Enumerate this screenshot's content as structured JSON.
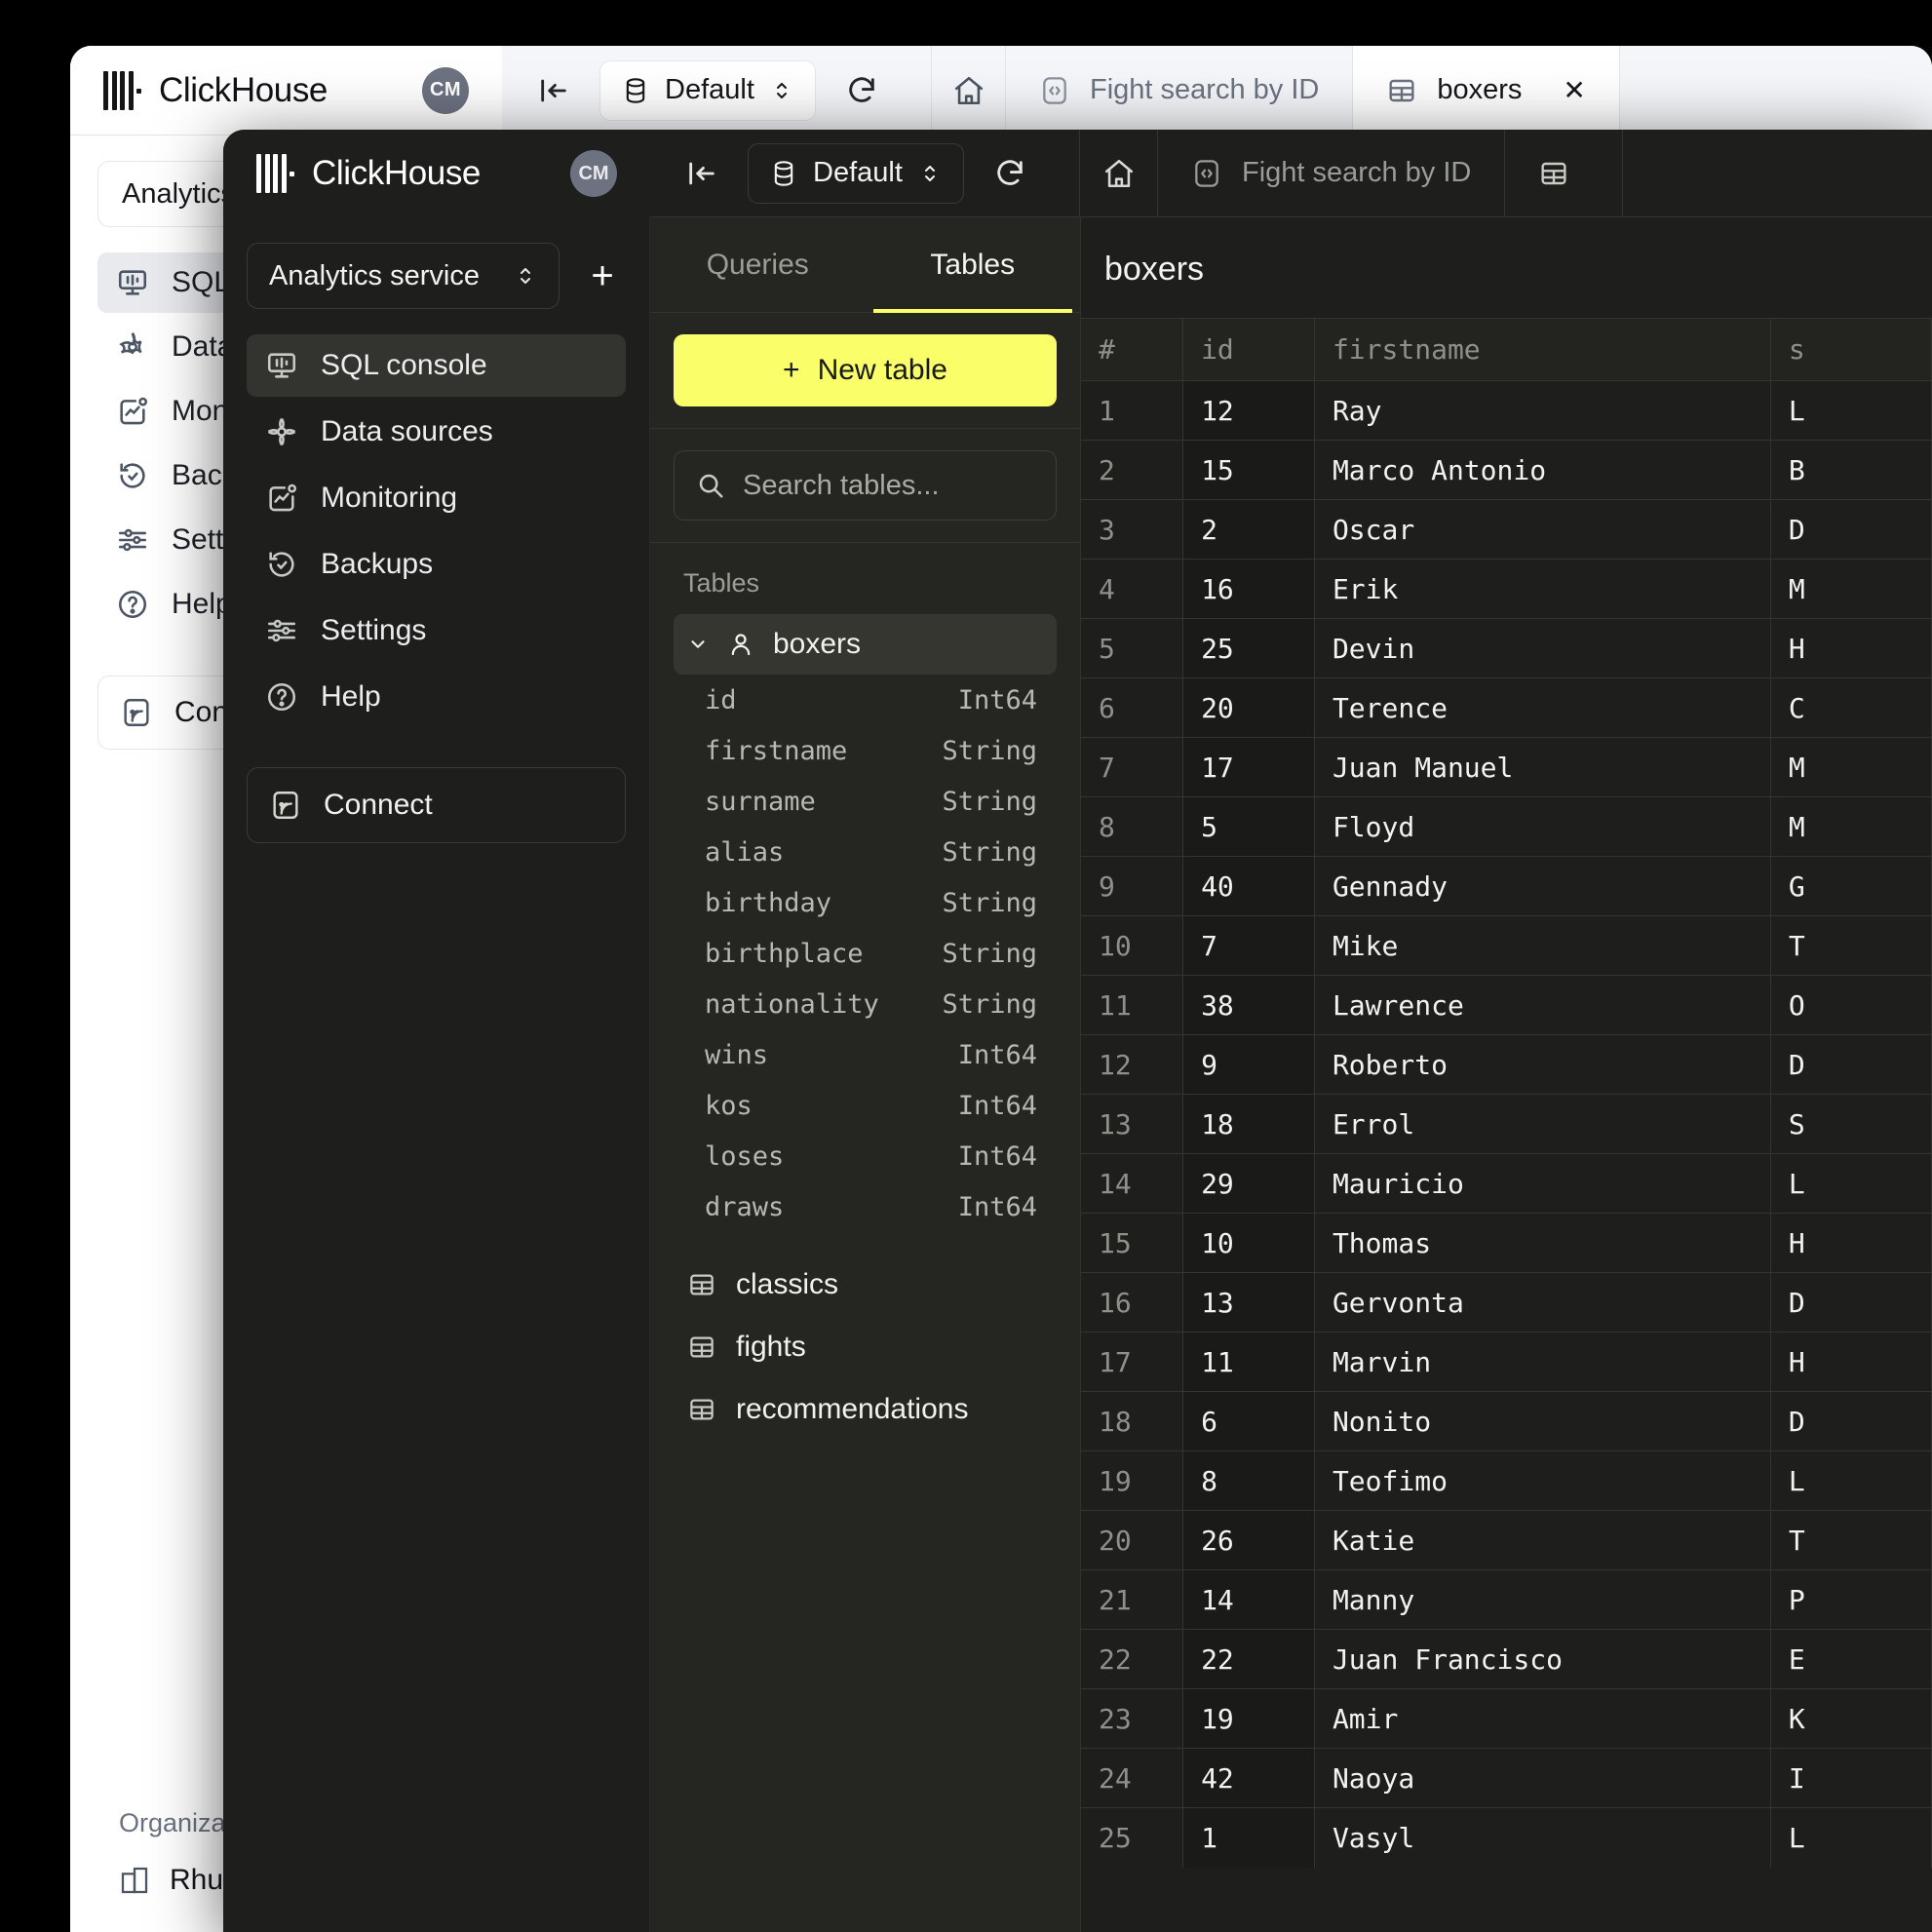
{
  "app": {
    "brand": "ClickHouse",
    "avatar_initials": "CM"
  },
  "base_window": {
    "toolbar": {
      "collapse_icon": "collapse-left-icon",
      "database_label": "Default",
      "refresh_icon": "refresh-icon",
      "home_icon": "home-icon"
    },
    "tabs": [
      {
        "label": "Fight search by ID",
        "icon": "code-square-icon",
        "active": false
      },
      {
        "label": "boxers",
        "icon": "table-icon",
        "active": true,
        "close_label": "✕"
      }
    ],
    "sidebar": {
      "service_selector": "Analytics service",
      "items": [
        {
          "label": "SQL console",
          "icon": "sql-console-icon",
          "active": true
        },
        {
          "label": "Data sources",
          "icon": "data-sources-icon",
          "active": false
        },
        {
          "label": "Monitoring",
          "icon": "monitoring-icon",
          "active": false
        },
        {
          "label": "Backups",
          "icon": "backups-icon",
          "active": false
        },
        {
          "label": "Settings",
          "icon": "settings-icon",
          "active": false
        },
        {
          "label": "Help",
          "icon": "help-icon",
          "active": false
        }
      ],
      "connect_label": "Connect",
      "organization_label": "Organization",
      "organization_name": "Rhubarb"
    }
  },
  "dark_window": {
    "toolbar": {
      "collapse_icon": "collapse-left-icon",
      "database_label": "Default",
      "refresh_icon": "refresh-icon",
      "home_icon": "home-icon"
    },
    "tabs": [
      {
        "label": "Fight search by ID",
        "icon": "code-square-icon"
      },
      {
        "label": "",
        "icon": "table-icon"
      }
    ],
    "sidebar": {
      "service_selector": "Analytics service",
      "add_button": "+",
      "items": [
        {
          "label": "SQL console",
          "icon": "sql-console-icon",
          "active": true
        },
        {
          "label": "Data sources",
          "icon": "data-sources-icon",
          "active": false
        },
        {
          "label": "Monitoring",
          "icon": "monitoring-icon",
          "active": false
        },
        {
          "label": "Backups",
          "icon": "backups-icon",
          "active": false
        },
        {
          "label": "Settings",
          "icon": "settings-icon",
          "active": false
        },
        {
          "label": "Help",
          "icon": "help-icon",
          "active": false
        }
      ],
      "connect_label": "Connect"
    },
    "tables_panel": {
      "tabs": [
        {
          "label": "Queries",
          "active": false
        },
        {
          "label": "Tables",
          "active": true
        }
      ],
      "new_table_label": "New table",
      "new_table_plus": "+",
      "search_placeholder": "Search tables...",
      "section_label": "Tables",
      "expanded_table": {
        "name": "boxers",
        "icon": "user-table-icon",
        "chevron": "chevron-down-icon"
      },
      "columns": [
        {
          "name": "id",
          "type": "Int64"
        },
        {
          "name": "firstname",
          "type": "String"
        },
        {
          "name": "surname",
          "type": "String"
        },
        {
          "name": "alias",
          "type": "String"
        },
        {
          "name": "birthday",
          "type": "String"
        },
        {
          "name": "birthplace",
          "type": "String"
        },
        {
          "name": "nationality",
          "type": "String"
        },
        {
          "name": "wins",
          "type": "Int64"
        },
        {
          "name": "kos",
          "type": "Int64"
        },
        {
          "name": "loses",
          "type": "Int64"
        },
        {
          "name": "draws",
          "type": "Int64"
        }
      ],
      "other_tables": [
        {
          "name": "classics",
          "icon": "table-icon"
        },
        {
          "name": "fights",
          "icon": "table-icon"
        },
        {
          "name": "recommendations",
          "icon": "table-icon"
        }
      ]
    },
    "results": {
      "title": "boxers",
      "columns": [
        "#",
        "id",
        "firstname",
        "s"
      ],
      "rows": [
        {
          "n": "1",
          "id": "12",
          "firstname": "Ray",
          "surname": "L"
        },
        {
          "n": "2",
          "id": "15",
          "firstname": "Marco Antonio",
          "surname": "B"
        },
        {
          "n": "3",
          "id": "2",
          "firstname": "Oscar",
          "surname": "D"
        },
        {
          "n": "4",
          "id": "16",
          "firstname": "Erik",
          "surname": "M"
        },
        {
          "n": "5",
          "id": "25",
          "firstname": "Devin",
          "surname": "H"
        },
        {
          "n": "6",
          "id": "20",
          "firstname": "Terence",
          "surname": "C"
        },
        {
          "n": "7",
          "id": "17",
          "firstname": "Juan Manuel",
          "surname": "M"
        },
        {
          "n": "8",
          "id": "5",
          "firstname": "Floyd",
          "surname": "M"
        },
        {
          "n": "9",
          "id": "40",
          "firstname": "Gennady",
          "surname": "G"
        },
        {
          "n": "10",
          "id": "7",
          "firstname": "Mike",
          "surname": "T"
        },
        {
          "n": "11",
          "id": "38",
          "firstname": "Lawrence",
          "surname": "O"
        },
        {
          "n": "12",
          "id": "9",
          "firstname": "Roberto",
          "surname": "D"
        },
        {
          "n": "13",
          "id": "18",
          "firstname": "Errol",
          "surname": "S"
        },
        {
          "n": "14",
          "id": "29",
          "firstname": "Mauricio",
          "surname": "L"
        },
        {
          "n": "15",
          "id": "10",
          "firstname": "Thomas",
          "surname": "H"
        },
        {
          "n": "16",
          "id": "13",
          "firstname": "Gervonta",
          "surname": "D"
        },
        {
          "n": "17",
          "id": "11",
          "firstname": "Marvin",
          "surname": "H"
        },
        {
          "n": "18",
          "id": "6",
          "firstname": "Nonito",
          "surname": "D"
        },
        {
          "n": "19",
          "id": "8",
          "firstname": "Teofimo",
          "surname": "L"
        },
        {
          "n": "20",
          "id": "26",
          "firstname": "Katie",
          "surname": "T"
        },
        {
          "n": "21",
          "id": "14",
          "firstname": "Manny",
          "surname": "P"
        },
        {
          "n": "22",
          "id": "22",
          "firstname": "Juan Francisco",
          "surname": "E"
        },
        {
          "n": "23",
          "id": "19",
          "firstname": "Amir",
          "surname": "K"
        },
        {
          "n": "24",
          "id": "42",
          "firstname": "Naoya",
          "surname": "I"
        },
        {
          "n": "25",
          "id": "1",
          "firstname": "Vasyl",
          "surname": "L"
        }
      ]
    }
  },
  "colors": {
    "accent": "#faff69",
    "dark_bg": "#1e1f1d",
    "panel_bg": "#252621",
    "avatar": "#6c7280"
  }
}
